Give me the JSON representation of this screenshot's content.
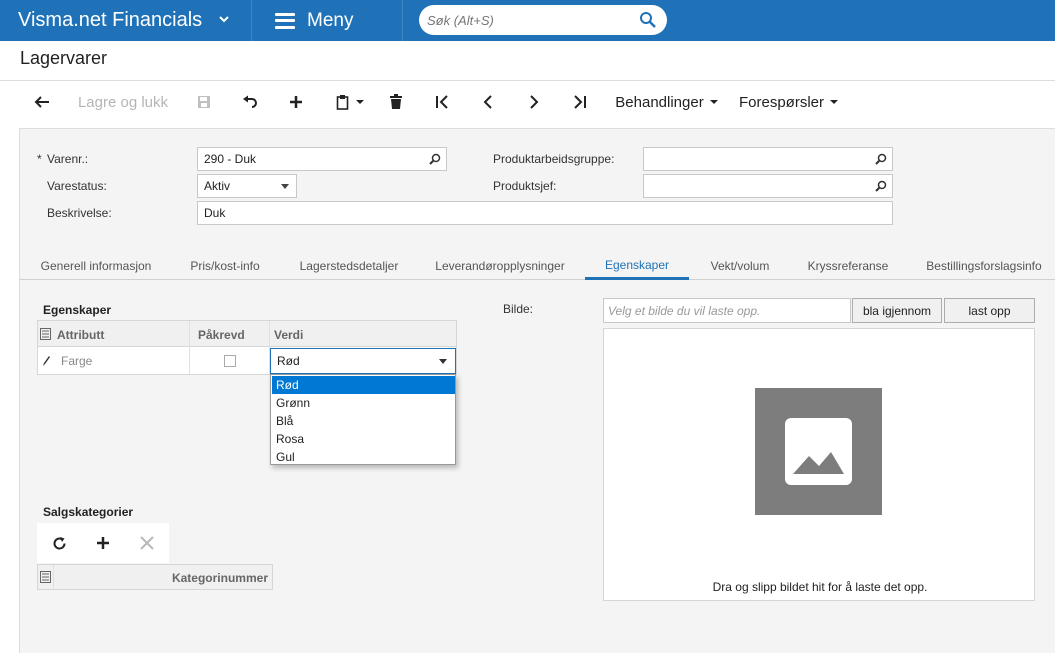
{
  "app": {
    "title": "Visma.net Financials",
    "menu_label": "Meny",
    "search_placeholder": "Søk (Alt+S)",
    "brand_color": "#1f72b8"
  },
  "page": {
    "title": "Lagervarer"
  },
  "toolbar": {
    "back_icon": "back-arrow-icon",
    "save_close_label": "Lagre og lukk",
    "save_icon": "save-icon",
    "undo_icon": "undo-icon",
    "add_icon": "plus-icon",
    "copy_paste_icon": "clipboard-icon",
    "delete_icon": "trash-icon",
    "first_icon": "first-record-icon",
    "prev_icon": "previous-icon",
    "next_icon": "next-icon",
    "last_icon": "last-record-icon",
    "actions_label": "Behandlinger",
    "inquiries_label": "Forespørsler"
  },
  "form": {
    "item_no_label": "Varenr.:",
    "item_no_required": "*",
    "item_no_value": "290 - Duk",
    "status_label": "Varestatus:",
    "status_value": "Aktiv",
    "description_label": "Beskrivelse:",
    "description_value": "Duk",
    "product_workgroup_label": "Produktarbeidsgruppe:",
    "product_workgroup_value": "",
    "product_manager_label": "Produktsjef:",
    "product_manager_value": ""
  },
  "tabs": [
    {
      "label": "Generell informasjon",
      "active": false
    },
    {
      "label": "Pris/kost-info",
      "active": false
    },
    {
      "label": "Lagerstedsdetaljer",
      "active": false
    },
    {
      "label": "Leverandøropplysninger",
      "active": false
    },
    {
      "label": "Egenskaper",
      "active": true
    },
    {
      "label": "Vekt/volum",
      "active": false
    },
    {
      "label": "Kryssreferanse",
      "active": false
    },
    {
      "label": "Bestillingsforslagsinfo",
      "active": false
    }
  ],
  "attributes": {
    "section_title": "Egenskaper",
    "columns": [
      "Attributt",
      "Påkrevd",
      "Verdi"
    ],
    "rows": [
      {
        "attribute": "Farge",
        "required": false,
        "value": "Rød"
      }
    ],
    "dropdown_options": [
      "Rød",
      "Grønn",
      "Blå",
      "Rosa",
      "Gul"
    ],
    "dropdown_selected": "Rød"
  },
  "image": {
    "label": "Bilde:",
    "file_placeholder": "Velg et bilde du vil laste opp.",
    "browse_label": "bla igjennom",
    "upload_label": "last opp",
    "drop_text": "Dra og slipp bildet hit for å laste det opp."
  },
  "sales_categories": {
    "section_title": "Salgskategorier",
    "columns": [
      "Kategorinummer"
    ]
  }
}
